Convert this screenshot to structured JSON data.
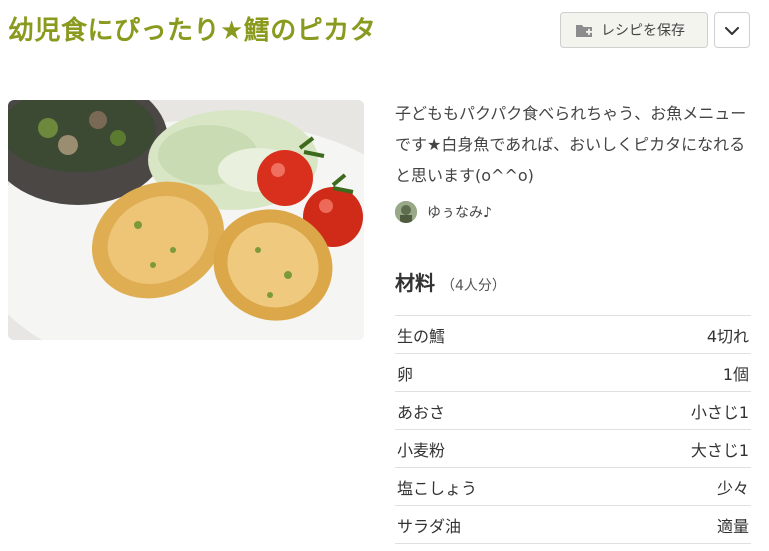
{
  "recipe": {
    "title": "幼児食にぴったり★鱈のピカタ",
    "description": "子どももパクパク食べられちゃう、お魚メニューです★白身魚であれば、おいしくピカタになれると思います(o^^o)",
    "author": "ゆぅなみ♪"
  },
  "actions": {
    "save_label": "レシピを保存",
    "save_icon": "folder-add-icon",
    "menu_icon": "chevron-down-icon"
  },
  "ingredients": {
    "title": "材料",
    "servings": "（4人分）",
    "items": [
      {
        "name": "生の鱈",
        "qty": "4切れ"
      },
      {
        "name": "卵",
        "qty": "1個"
      },
      {
        "name": "あおさ",
        "qty": "小さじ1"
      },
      {
        "name": "小麦粉",
        "qty": "大さじ1"
      },
      {
        "name": "塩こしょう",
        "qty": "少々"
      },
      {
        "name": "サラダ油",
        "qty": "適量"
      }
    ]
  },
  "colors": {
    "title": "#8a9a1f",
    "button_bg": "#f4f4ef",
    "divider": "#e0e0e0"
  }
}
